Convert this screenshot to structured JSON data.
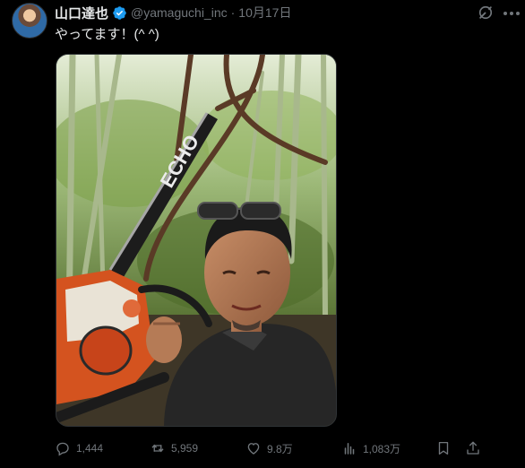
{
  "post": {
    "author_name": "山口達也",
    "author_handle": "@yamaguchi_inc",
    "separator": "·",
    "date": "10月17日",
    "text": "やってます！(^ ^)",
    "media_alt": "Man with sunglasses on head holding a chainsaw in a bamboo forest, selfie",
    "chainsaw_brand_text": "ECHO"
  },
  "actions": {
    "replies": "1,444",
    "reposts": "5,959",
    "likes": "9.8万",
    "views": "1,083万"
  },
  "colors": {
    "background": "#000000",
    "text": "#e7e9ea",
    "muted": "#71767b",
    "verified": "#1d9bf0"
  },
  "icons": {
    "verified": "verified-badge-icon",
    "grok": "grok-icon",
    "more": "more-dots-icon",
    "reply": "reply-icon",
    "repost": "repost-icon",
    "like": "heart-icon",
    "views": "views-chart-icon",
    "bookmark": "bookmark-icon",
    "share": "share-icon"
  }
}
